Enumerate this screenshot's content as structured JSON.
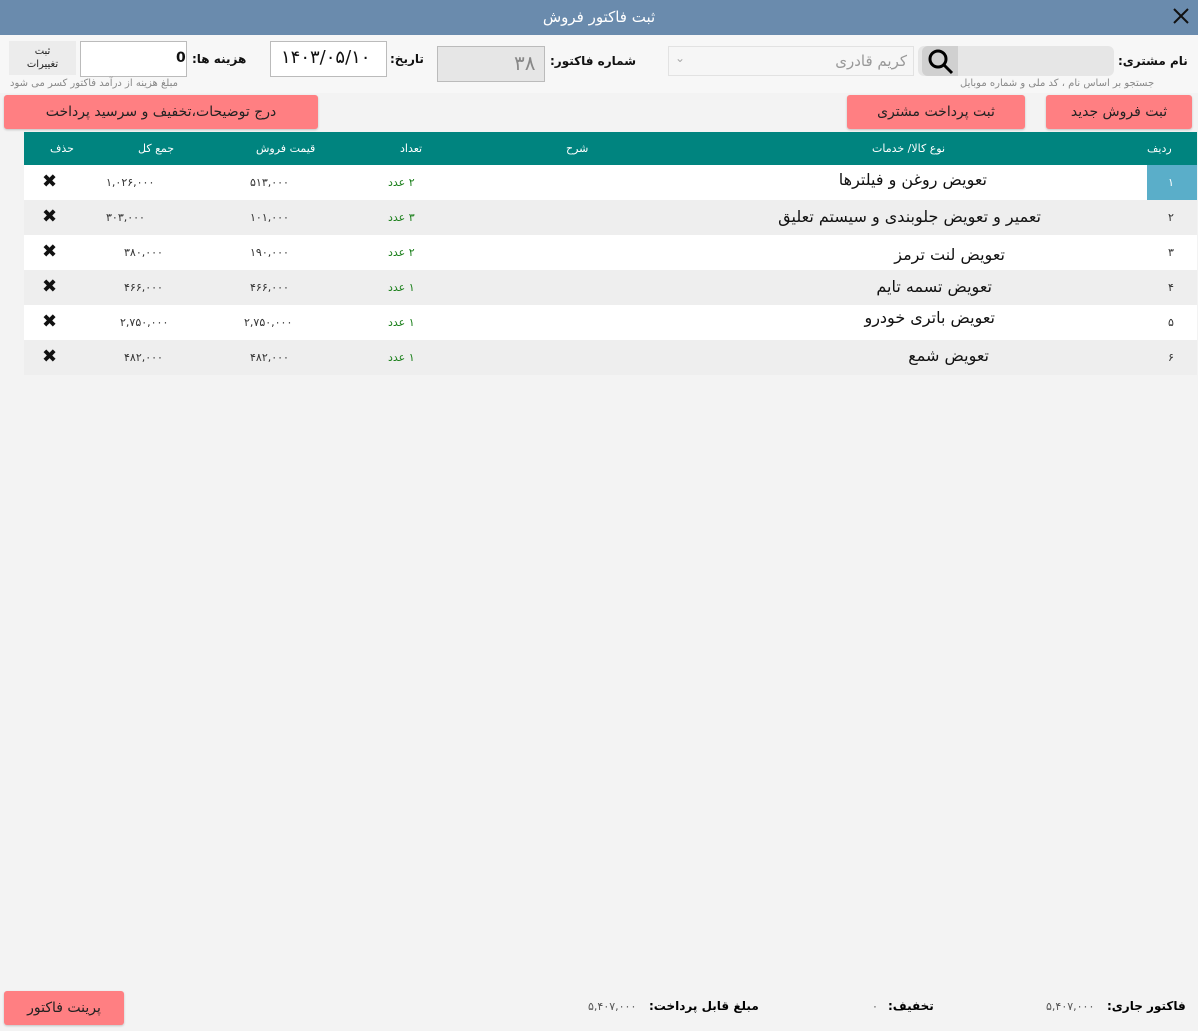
{
  "window": {
    "title": "ثبت فاکتور فروش"
  },
  "top": {
    "customer_label": "نام مشتری:",
    "customer_value": "کریم قادری",
    "customer_hint": "جستجو بر اساس نام ، کد ملی و شماره موبایل",
    "invoice_no_label": "شماره فاکتور:",
    "invoice_no": "۳۸",
    "date_label": "تاریخ:",
    "date_value": "۱۴۰۳/۰۵/۱۰",
    "expense_label": "هزینه ها:",
    "expense_value": "0",
    "expense_hint": "مبلغ هزینه از درآمد فاکتور کسر می شود",
    "save_changes_line1": "ثبت",
    "save_changes_line2": "تغییرات"
  },
  "actions": {
    "new_sale": "ثبت فروش جدید",
    "customer_payment": "ثبت پرداخت مشتری",
    "notes_discount": "درج توضیحات،تخفیف و سرسید پرداخت"
  },
  "table": {
    "headers": {
      "row": "ردیف",
      "service": "نوع کالا/ خدمات",
      "desc": "شرح",
      "qty": "تعداد",
      "price": "قیمت فروش",
      "total": "جمع کل",
      "delete": "حذف"
    },
    "rows": [
      {
        "num": "۱",
        "service": "تعویض روغن و فیلترها",
        "qty": "۲ عدد",
        "price": "۵۱۳,۰۰۰",
        "total": "۱,۰۲۶,۰۰۰",
        "del": "✖"
      },
      {
        "num": "۲",
        "service": "تعمیر و تعویض جلوبندی و سیستم تعلیق",
        "qty": "۳ عدد",
        "price": "۱۰۱,۰۰۰",
        "total": "۳۰۳,۰۰۰",
        "del": "✖"
      },
      {
        "num": "۳",
        "service": "تعویض لنت ترمز",
        "qty": "۲ عدد",
        "price": "۱۹۰,۰۰۰",
        "total": "۳۸۰,۰۰۰",
        "del": "✖"
      },
      {
        "num": "۴",
        "service": "تعویض تسمه تایم",
        "qty": "۱ عدد",
        "price": "۴۶۶,۰۰۰",
        "total": "۴۶۶,۰۰۰",
        "del": "✖"
      },
      {
        "num": "۵",
        "service": "تعویض باتری خودرو",
        "qty": "۱ عدد",
        "price": "۲,۷۵۰,۰۰۰",
        "total": "۲,۷۵۰,۰۰۰",
        "del": "✖"
      },
      {
        "num": "۶",
        "service": "تعویض شمع",
        "qty": "۱ عدد",
        "price": "۴۸۲,۰۰۰",
        "total": "۴۸۲,۰۰۰",
        "del": "✖"
      }
    ]
  },
  "footer": {
    "current_label": "فاکتور جاری:",
    "current_value": "۵,۴۰۷,۰۰۰",
    "discount_label": "تخفیف:",
    "discount_value": "۰",
    "payable_label": "مبلغ قابل پرداخت:",
    "payable_value": "۵,۴۰۷,۰۰۰",
    "print_label": "پرینت فاکتور"
  },
  "colors": {
    "titlebar": "#6a8bad",
    "header": "#00847f",
    "action": "#ff7f82",
    "selected": "#5aaec9"
  }
}
